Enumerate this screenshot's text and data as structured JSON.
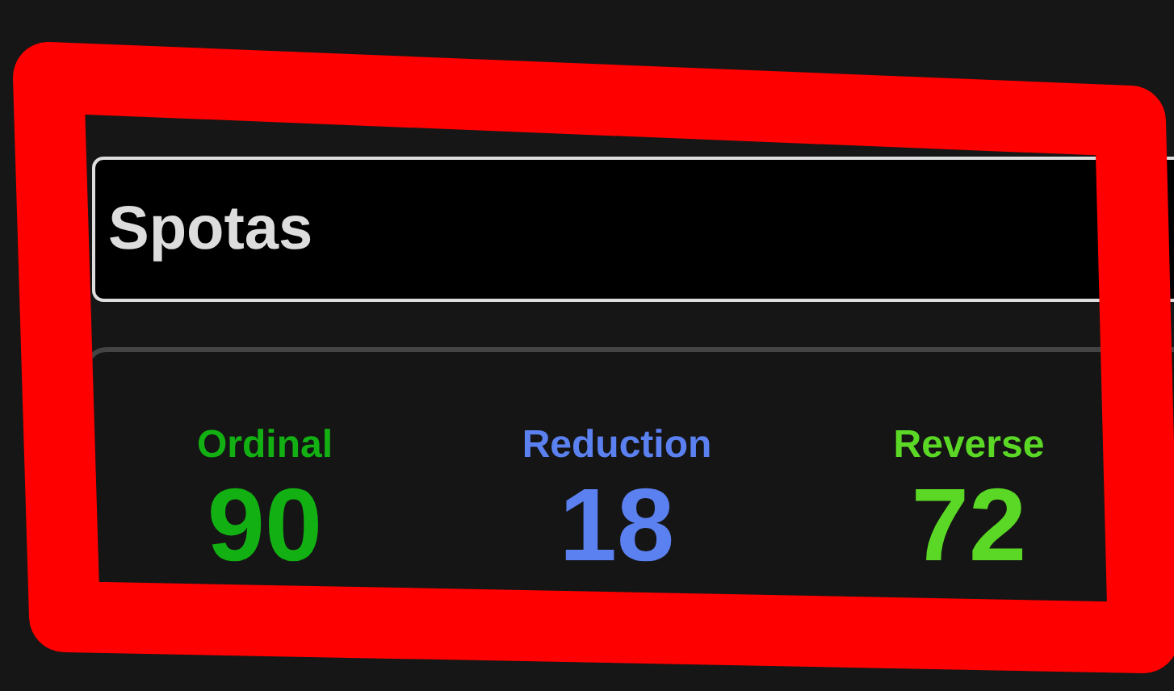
{
  "search": {
    "value": "Spotas"
  },
  "results": [
    {
      "cipher": "Ordinal",
      "value": "90",
      "color": "#12b012"
    },
    {
      "cipher": "Reduction",
      "value": "18",
      "color": "#5b80f0"
    },
    {
      "cipher": "Reverse",
      "value": "72",
      "color": "#5bd825"
    }
  ]
}
